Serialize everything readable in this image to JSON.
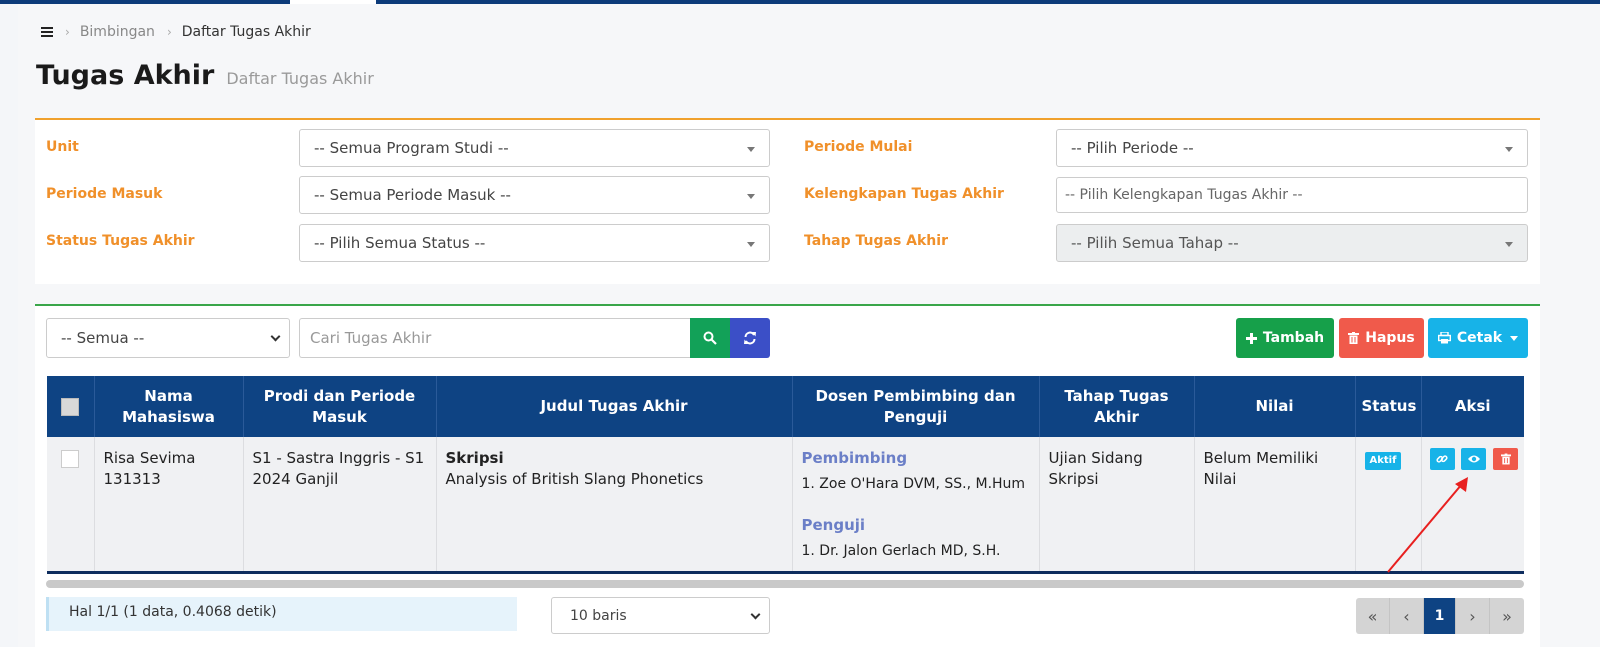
{
  "breadcrumb": {
    "items": [
      "Bimbingan",
      "Daftar Tugas Akhir"
    ]
  },
  "page": {
    "title": "Tugas Akhir",
    "subtitle": "Daftar Tugas Akhir"
  },
  "filters": {
    "unit": {
      "label": "Unit",
      "value": "-- Semua Program Studi --"
    },
    "periode_masuk": {
      "label": "Periode Masuk",
      "value": "-- Semua Periode Masuk --"
    },
    "status": {
      "label": "Status Tugas Akhir",
      "value": "-- Pilih Semua Status --"
    },
    "periode_mulai": {
      "label": "Periode Mulai",
      "value": "-- Pilih Periode --"
    },
    "kelengkapan": {
      "label": "Kelengkapan Tugas Akhir",
      "placeholder": "-- Pilih Kelengkapan Tugas Akhir --"
    },
    "tahap": {
      "label": "Tahap Tugas Akhir",
      "value": "-- Pilih Semua Tahap --"
    }
  },
  "toolbar": {
    "scope_value": "-- Semua --",
    "search_placeholder": "Cari Tugas Akhir",
    "add_label": "Tambah",
    "delete_label": "Hapus",
    "print_label": "Cetak"
  },
  "table": {
    "headers": [
      "Nama Mahasiswa",
      "Prodi dan Periode Masuk",
      "Judul Tugas Akhir",
      "Dosen Pembimbing dan Penguji",
      "Tahap Tugas Akhir",
      "Nilai",
      "Status",
      "Aksi"
    ],
    "rows": [
      {
        "name": "Risa Sevima",
        "nim": "131313",
        "prodi": "S1 - Sastra Inggris - S1 2024 Ganjil",
        "jenis": "Skripsi",
        "judul": "Analysis of British Slang Phonetics",
        "pembimbing_label": "Pembimbing",
        "pembimbing": "1. Zoe O'Hara DVM, SS., M.Hum",
        "penguji_label": "Penguji",
        "penguji": "1. Dr. Jalon Gerlach MD, S.H.",
        "tahap": "Ujian Sidang Skripsi",
        "nilai": "Belum Memiliki Nilai",
        "status": "Aktif"
      }
    ]
  },
  "footer": {
    "info": "Hal 1/1 (1 data, 0.4068 detik)",
    "rows_value": "10 baris",
    "pagination": {
      "first": "«",
      "prev": "‹",
      "current": "1",
      "next": "›",
      "last": "»"
    }
  },
  "colors": {
    "navy": "#0e4383",
    "orange": "#f0902a",
    "green": "#16a04a",
    "red": "#f05a4b",
    "cyan": "#17b3e8",
    "annotation": "#e8201f"
  }
}
